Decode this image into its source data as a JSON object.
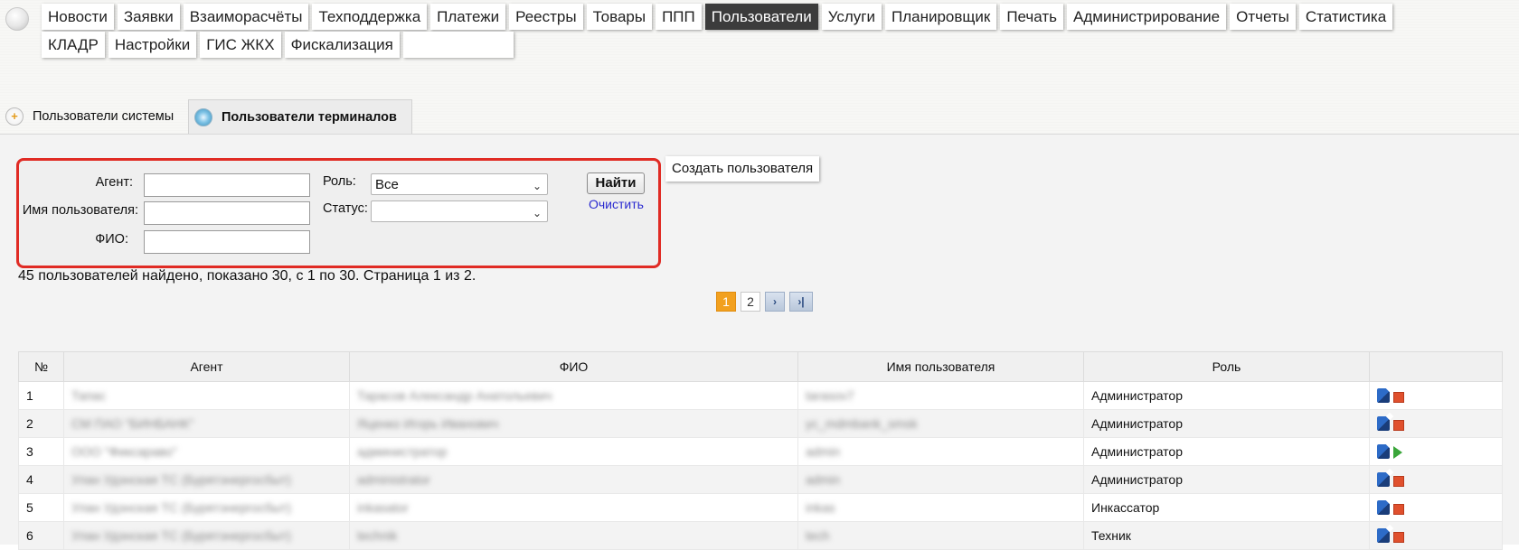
{
  "menu": {
    "row1": [
      "Новости",
      "Заявки",
      "Взаиморасчёты",
      "Техподдержка",
      "Платежи",
      "Реестры",
      "Товары",
      "ППП",
      "Пользователи",
      "Услуги",
      "Планировщик",
      "Печать",
      "Администрирование",
      "Отчеты",
      "Статистика"
    ],
    "row2": [
      "КЛАДР",
      "Настройки",
      "ГИС ЖКХ",
      "Фискализация"
    ],
    "active": "Пользователи"
  },
  "tabs": {
    "system_users": "Пользователи системы",
    "terminal_users": "Пользователи терминалов"
  },
  "filters": {
    "agent_label": "Агент:",
    "agent_value": "",
    "username_label": "Имя пользователя:",
    "username_value": "",
    "fio_label": "ФИО:",
    "fio_value": "",
    "role_label": "Роль:",
    "role_value": "Все",
    "status_label": "Статус:",
    "status_value": "",
    "find_button": "Найти",
    "clear_link": "Очистить"
  },
  "create_user_button": "Создать пользователя",
  "summary": "45 пользователей найдено, показано 30, с 1 по 30. Страница 1 из 2.",
  "pager": {
    "current": "1",
    "next_page": "2",
    "next_icon": "›",
    "last_icon": "›|"
  },
  "table": {
    "headers": [
      "№",
      "Агент",
      "ФИО",
      "Имя пользователя",
      "Роль",
      ""
    ],
    "rows": [
      {
        "num": "1",
        "agent": "Тапас",
        "fio": "Тарасов Александр Анатольевич",
        "username": "tarasov7",
        "role": "Администратор",
        "action": "stop"
      },
      {
        "num": "2",
        "agent": "СМ ПАО \"БИНБАНК\"",
        "fio": "Яценко Игорь Иванович",
        "username": "yc_mdmbank_smsk",
        "role": "Администратор",
        "action": "stop"
      },
      {
        "num": "3",
        "agent": "ООО \"Фиксараво\"",
        "fio": "администратор",
        "username": "admin",
        "role": "Администратор",
        "action": "play"
      },
      {
        "num": "4",
        "agent": "Улан Удэнская ТС (Бурятэнергосбыт)",
        "fio": "administrator",
        "username": "admin",
        "role": "Администратор",
        "action": "stop"
      },
      {
        "num": "5",
        "agent": "Улан Удэнская ТС (Бурятэнергосбыт)",
        "fio": "inkasator",
        "username": "inkas",
        "role": "Инкассатор",
        "action": "stop"
      },
      {
        "num": "6",
        "agent": "Улан Удэнская ТС (Бурятэнергосбыт)",
        "fio": "technik",
        "username": "tech",
        "role": "Техник",
        "action": "stop"
      }
    ]
  },
  "colors": {
    "highlight_border": "#e02b24",
    "active_menu": "#3c3c3c",
    "pager_current": "#f2a01e",
    "link": "#2a2ad0"
  }
}
